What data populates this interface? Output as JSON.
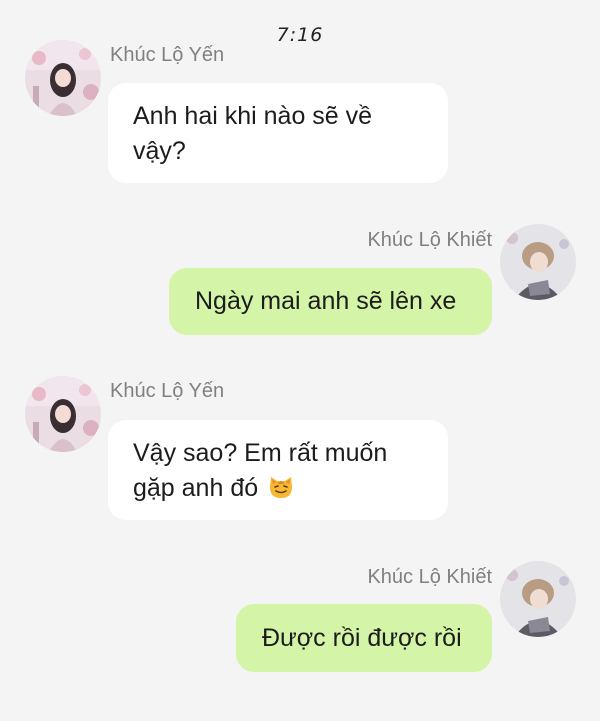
{
  "status_bar": {
    "time": "7:16"
  },
  "messages": [
    {
      "sender": "Khúc Lộ Yến",
      "direction": "incoming",
      "lines": [
        "Anh hai khi nào sẽ về",
        "vậy?"
      ]
    },
    {
      "sender": "Khúc Lộ Khiết",
      "direction": "outgoing",
      "lines": [
        "Ngày mai anh sẽ lên xe"
      ]
    },
    {
      "sender": "Khúc Lộ Yến",
      "direction": "incoming",
      "lines": [
        "Vậy sao? Em rất muốn",
        "gặp anh đó"
      ],
      "emoji": "cat-face-emoji"
    },
    {
      "sender": "Khúc Lộ Khiết",
      "direction": "outgoing",
      "lines": [
        "Được rồi được rồi"
      ]
    }
  ],
  "colors": {
    "background": "#f4f4f4",
    "incoming_bubble": "#ffffff",
    "outgoing_bubble": "#d4f4a8",
    "sender_name": "#808080"
  }
}
